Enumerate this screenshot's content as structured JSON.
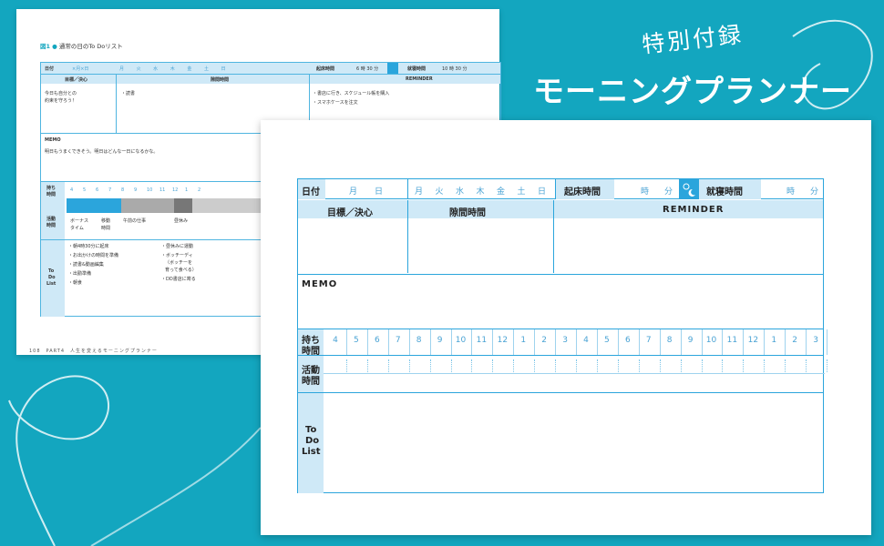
{
  "title": {
    "sub": "特別付録",
    "main": "モーニングプランナー"
  },
  "back_page": {
    "caption_fig": "図1",
    "caption_text": "通常の日のTo Doリスト",
    "date_label": "日付",
    "date_value": "×月×日",
    "weekdays": "月 火 水 木 金 土 日",
    "wake_label": "起床時間",
    "wake_value": "6 時 30 分",
    "sleep_label": "就寝時間",
    "sleep_value": "10 時 30 分",
    "goal_header": "目標／決心",
    "gap_header": "隙間時間",
    "reminder_header": "REMINDER",
    "goal_text1": "今日も自分との",
    "goal_text2": "約束を守ろう！",
    "gap_text": "・読書",
    "rem_text1": "・書店に行き、スケジュール帳を購入",
    "rem_text2": "・スマホケースを注文",
    "memo_label": "MEMO",
    "memo_text": "明日もうまくできそう。明日はどんな一日になるかな。",
    "hours_label1": "持ち",
    "hours_label2": "時間",
    "hours": [
      "4",
      "5",
      "6",
      "7",
      "8",
      "9",
      "10",
      "11",
      "12",
      "1",
      "2"
    ],
    "activity_label1": "活動",
    "activity_label2": "時間",
    "activities": [
      "ボーナス",
      "タイム",
      "移動",
      "時間",
      "午前の仕事",
      "昼休み"
    ],
    "todo_label": [
      "To",
      "Do",
      "List"
    ],
    "todo_left": [
      "・朝4時30分に起床",
      "・お出かけの時間を準備",
      "・読書&動画編集",
      "・出勤準備",
      "・朝食"
    ],
    "todo_right": [
      "・昼休みに運動",
      "・ボッチーディ",
      "（ボッチーを",
      "育って食べる）",
      "・DD書店に寄る"
    ],
    "footer": "108　PART4　人生を変えるモーニングプランナー"
  },
  "front_page": {
    "date_label": "日付",
    "month": "月",
    "day": "日",
    "weekdays": [
      "月",
      "火",
      "水",
      "木",
      "金",
      "土",
      "日"
    ],
    "wake_label": "起床時間",
    "hour_unit": "時",
    "min_unit": "分",
    "sleep_label": "就寝時間",
    "goal_header": "目標／決心",
    "gap_header": "隙間時間",
    "reminder_header": "REMINDER",
    "memo_label": "MEMO",
    "hours_label": [
      "持ち",
      "時間"
    ],
    "hours": [
      "4",
      "5",
      "6",
      "7",
      "8",
      "9",
      "10",
      "11",
      "12",
      "1",
      "2",
      "3",
      "4",
      "5",
      "6",
      "7",
      "8",
      "9",
      "10",
      "11",
      "12",
      "1",
      "2",
      "3"
    ],
    "activity_label": [
      "活動",
      "時間"
    ],
    "todo_label": [
      "To",
      "Do",
      "List"
    ]
  },
  "colors": {
    "background": "#13a6bf",
    "accent": "#2ba5dc",
    "header_fill": "#cfe9f7"
  }
}
